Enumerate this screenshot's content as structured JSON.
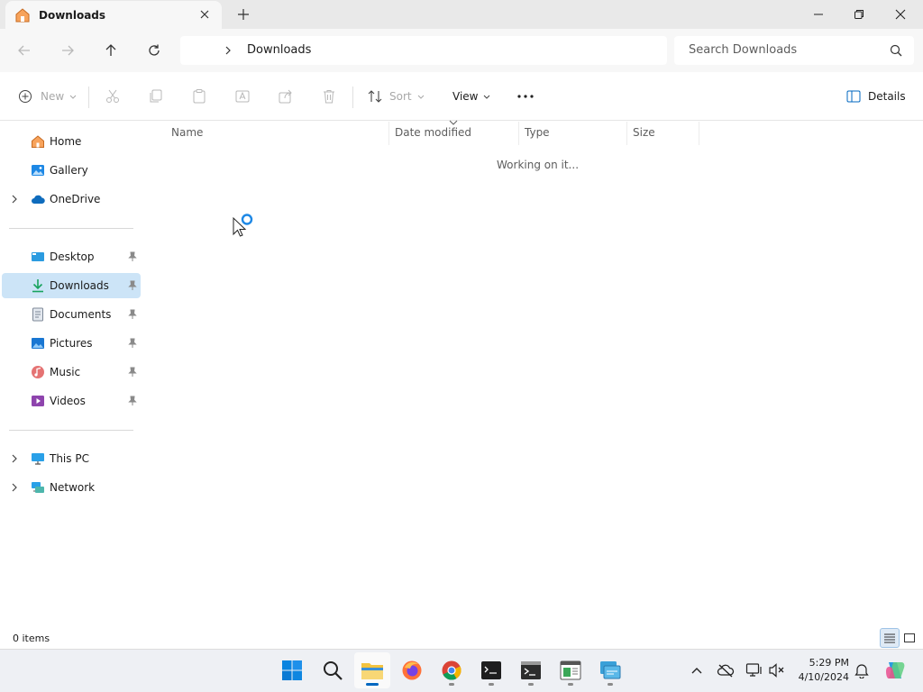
{
  "window": {
    "tab_title": "Downloads",
    "icons": {
      "tab": "home-icon",
      "close_tab": "close-icon",
      "new_tab": "plus-icon"
    }
  },
  "address": {
    "path_current": "Downloads",
    "search_placeholder": "Search Downloads"
  },
  "toolbar": {
    "new_label": "New",
    "sort_label": "Sort",
    "view_label": "View",
    "details_label": "Details"
  },
  "sidebar": {
    "top": [
      {
        "label": "Home",
        "icon": "home-icon"
      },
      {
        "label": "Gallery",
        "icon": "gallery-icon"
      },
      {
        "label": "OneDrive",
        "icon": "cloud-icon"
      }
    ],
    "quick": [
      {
        "label": "Desktop",
        "icon": "desktop-icon"
      },
      {
        "label": "Downloads",
        "icon": "download-icon",
        "selected": true
      },
      {
        "label": "Documents",
        "icon": "document-icon"
      },
      {
        "label": "Pictures",
        "icon": "pictures-icon"
      },
      {
        "label": "Music",
        "icon": "music-icon"
      },
      {
        "label": "Videos",
        "icon": "videos-icon"
      }
    ],
    "devices": [
      {
        "label": "This PC",
        "icon": "computer-icon"
      },
      {
        "label": "Network",
        "icon": "network-icon"
      }
    ]
  },
  "columns": [
    "Name",
    "Date modified",
    "Type",
    "Size"
  ],
  "content": {
    "loading_text": "Working on it..."
  },
  "status": {
    "item_count": "0 items"
  },
  "taskbar": {
    "time": "5:29 PM",
    "date": "4/10/2024"
  },
  "colors": {
    "accent": "#0067c0",
    "selected_bg": "#cce4f7",
    "folder_yellow": "#f3c33f"
  }
}
